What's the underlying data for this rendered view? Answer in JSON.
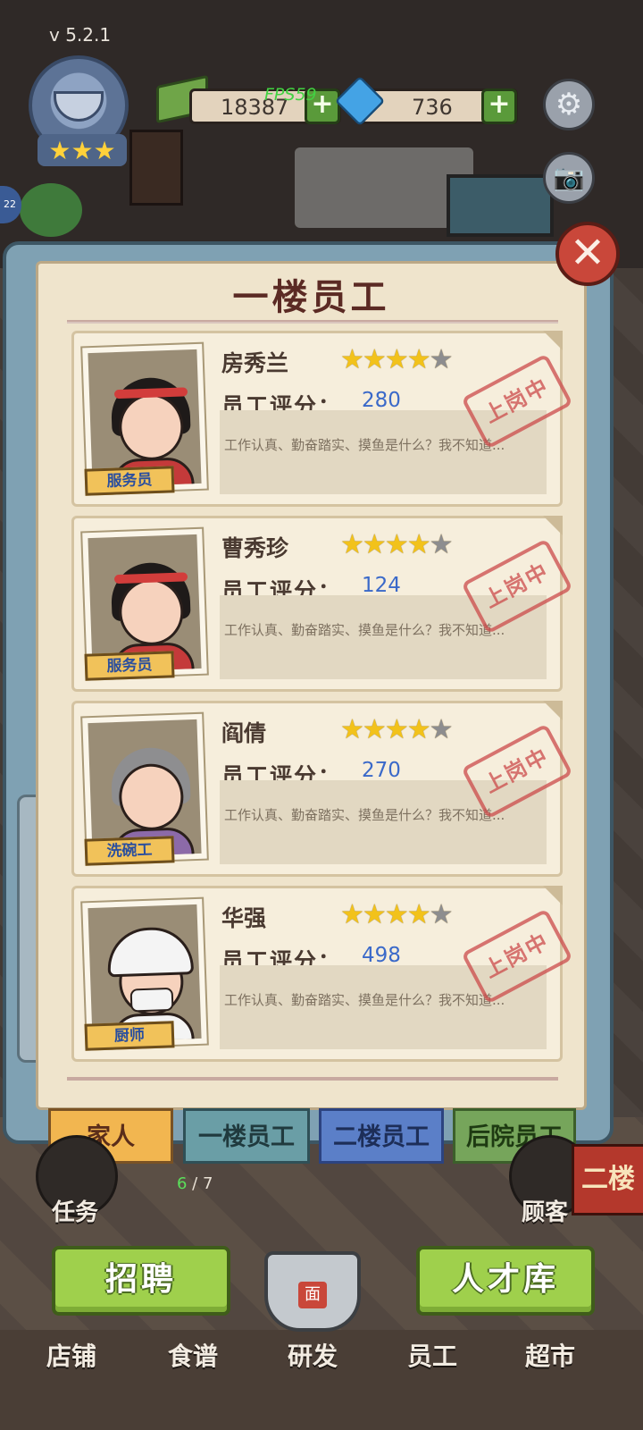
{
  "app": {
    "version": "v  5.2.1",
    "fps": "FPS59",
    "left_tab_badge": "22"
  },
  "resources": {
    "money": "18387",
    "gems": "736",
    "plus": "+"
  },
  "badge": {
    "stars": "★★★"
  },
  "dialog": {
    "title": "一楼员工",
    "close_symbol": "✕"
  },
  "employees": [
    {
      "name": "房秀兰",
      "rating": 4,
      "max_rating": 5,
      "score_label": "员工评分：",
      "score": "280",
      "description": "工作认真、勤奋踏实、摸鱼是什么？我不知道...",
      "status": "上岗中",
      "role": "服务员"
    },
    {
      "name": "曹秀珍",
      "rating": 4,
      "max_rating": 5,
      "score_label": "员工评分：",
      "score": "124",
      "description": "工作认真、勤奋踏实、摸鱼是什么？我不知道...",
      "status": "上岗中",
      "role": "服务员"
    },
    {
      "name": "阎倩",
      "rating": 4,
      "max_rating": 5,
      "score_label": "员工评分：",
      "score": "270",
      "description": "工作认真、勤奋踏实、摸鱼是什么？我不知道...",
      "status": "上岗中",
      "role": "洗碗工"
    },
    {
      "name": "华强",
      "rating": 4,
      "max_rating": 5,
      "score_label": "员工评分：",
      "score": "498",
      "description": "工作认真、勤奋踏实、摸鱼是什么？我不知道...",
      "status": "上岗中",
      "role": "厨师"
    }
  ],
  "tabs": [
    {
      "label": "家人"
    },
    {
      "label": "一楼员工"
    },
    {
      "label": "二楼员工"
    },
    {
      "label": "后院员工"
    }
  ],
  "hud": {
    "task_label": "任务",
    "task_progress_done": "6",
    "task_progress_total": " / 7",
    "guest_label": "顾客",
    "sign_text": "二楼"
  },
  "buttons": {
    "recruit": "招聘",
    "talent_pool": "人才库",
    "pot_mark": "面"
  },
  "nav": [
    {
      "label": "店铺"
    },
    {
      "label": "食谱"
    },
    {
      "label": "研发"
    },
    {
      "label": "员工"
    },
    {
      "label": "超市"
    }
  ],
  "colors": {
    "star_on": "#f2c21b",
    "star_off": "#8d8d8f",
    "score": "#3a69c9",
    "stamp": "#cc4b4b",
    "button_green": "#9fd04c"
  }
}
